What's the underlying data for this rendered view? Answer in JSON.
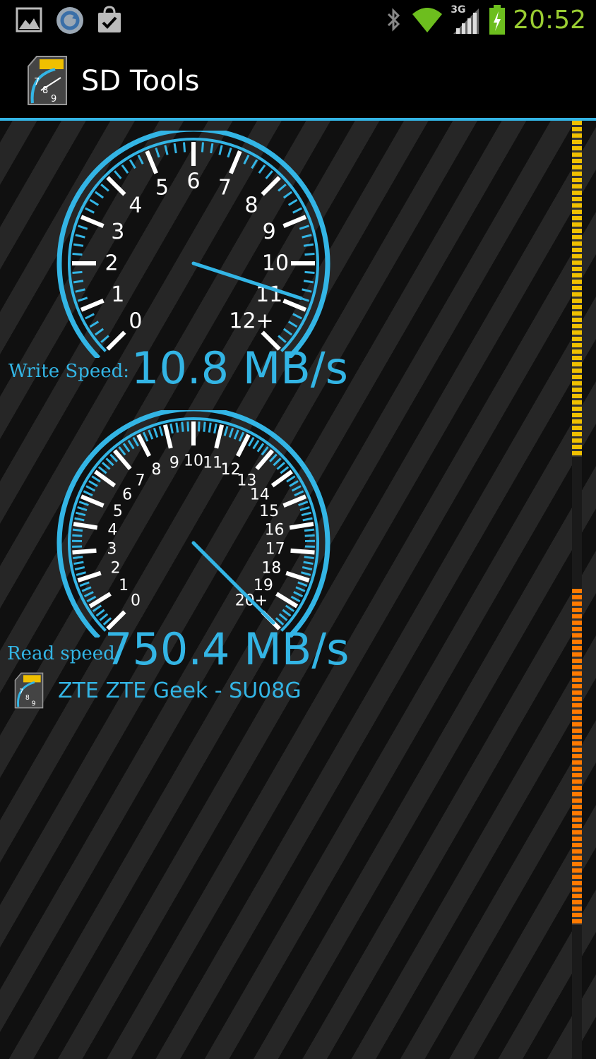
{
  "status_bar": {
    "time": "20:52",
    "network_type": "3G",
    "icons": [
      "gallery-icon",
      "sync-icon",
      "store-icon",
      "bluetooth-icon",
      "wifi-icon",
      "signal-icon",
      "battery-charging-icon"
    ]
  },
  "action_bar": {
    "title": "SD Tools",
    "app_icon": "sd-card-speedometer-icon"
  },
  "write_gauge": {
    "ticks": [
      "0",
      "1",
      "2",
      "3",
      "4",
      "5",
      "6",
      "7",
      "8",
      "9",
      "10",
      "11",
      "12+"
    ],
    "max": 12,
    "needle_value": 10.8
  },
  "write_speed": {
    "label": "Write Speed:",
    "value": "10.8 MB/s"
  },
  "read_gauge": {
    "ticks": [
      "0",
      "1",
      "2",
      "3",
      "4",
      "5",
      "6",
      "7",
      "8",
      "9",
      "10",
      "11",
      "12",
      "13",
      "14",
      "15",
      "16",
      "17",
      "18",
      "19",
      "20+"
    ],
    "max": 20,
    "needle_value": 20
  },
  "read_speed": {
    "label": "Read speed:",
    "value": "750.4 MB/s"
  },
  "device": {
    "name": "ZTE ZTE Geek - SU08G",
    "icon": "sd-card-speedometer-icon"
  },
  "colors": {
    "accent": "#33b5e5",
    "clock": "#9acd32",
    "scroll_top": "#f0c000",
    "scroll_bottom": "#ff7a00"
  }
}
